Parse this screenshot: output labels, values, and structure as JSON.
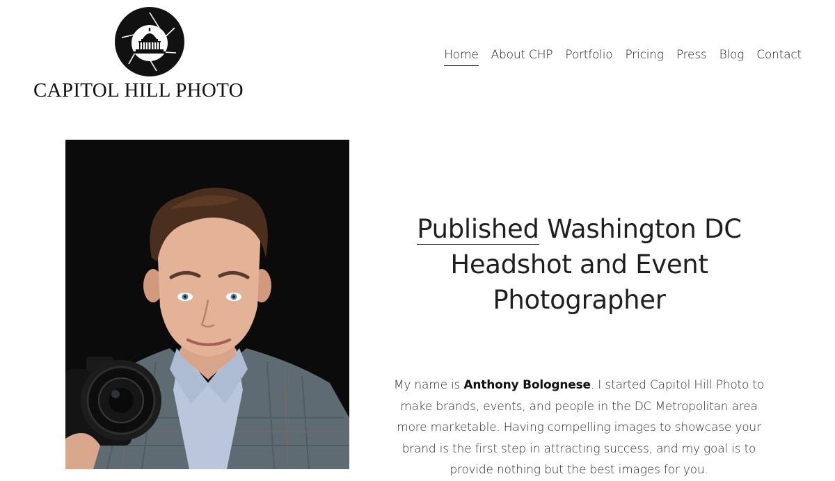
{
  "brand": {
    "name": "CAPITOL HILL PHOTO",
    "logo_icon": "aperture-capitol-dome-icon"
  },
  "nav": {
    "items": [
      {
        "label": "Home",
        "active": true
      },
      {
        "label": "About CHP",
        "active": false
      },
      {
        "label": "Portfolio",
        "active": false
      },
      {
        "label": "Pricing",
        "active": false
      },
      {
        "label": "Press",
        "active": false
      },
      {
        "label": "Blog",
        "active": false
      },
      {
        "label": "Contact",
        "active": false
      }
    ]
  },
  "hero": {
    "headline_link": "Published",
    "headline_rest": "Washington DC Headshot and Event Photographer",
    "bio_intro": "My name is ",
    "bio_name": "Anthony Bolognese",
    "bio_text": ". I started Capitol Hill Photo to make brands, events, and people in the DC Metropolitan area more marketable. Having compelling images to showcase your brand is the first step in attracting success, and my goal is to provide nothing but the best images for you."
  },
  "portrait": {
    "subject": "photographer-portrait-with-camera"
  },
  "colors": {
    "text": "#1f1f1f",
    "background": "#ffffff",
    "photo_bg": "#0b0b0b"
  }
}
